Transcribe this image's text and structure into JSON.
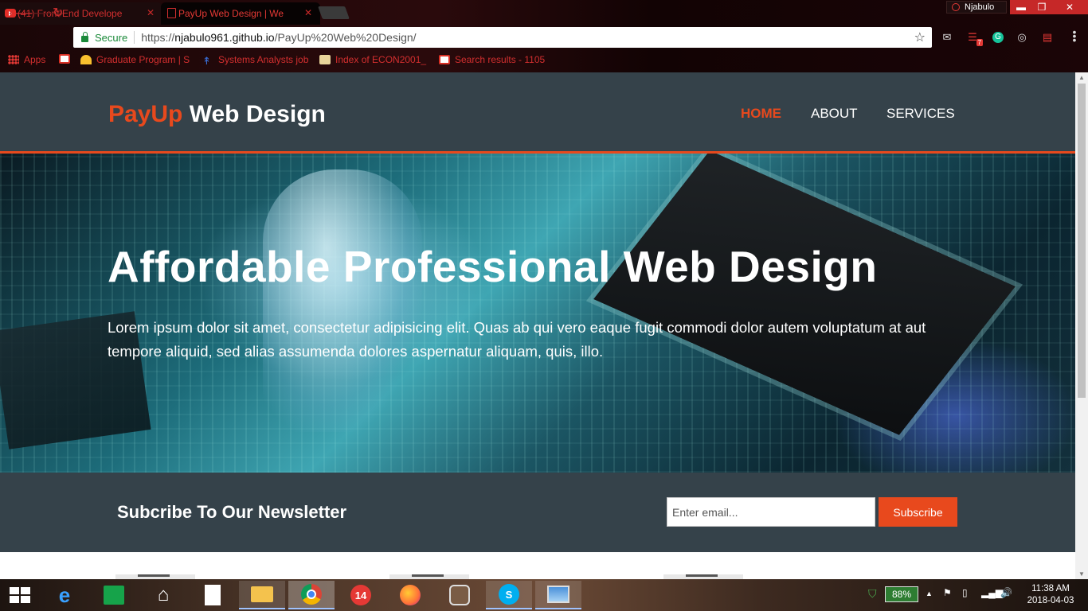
{
  "browser": {
    "tabs": [
      {
        "title": "(41) Front End Develope",
        "state": "inactive"
      },
      {
        "title": "PayUp Web Design | We",
        "state": "active"
      }
    ],
    "profile_name": "Njabulo",
    "window_controls": {
      "minimize": "▬",
      "maximize": "❐",
      "close": "✕"
    },
    "omnibox": {
      "secure_label": "Secure",
      "url_scheme": "https://",
      "url_host": "njabulo961.github.io",
      "url_path": "/PayUp%20Web%20Design/"
    },
    "extension_badges": {
      "mail": "",
      "todoist": "7"
    },
    "bookmarks": [
      {
        "label": "Apps",
        "icon": "apps-grid-icon"
      },
      {
        "label": "",
        "icon": "gmail-icon"
      },
      {
        "label": "Graduate Program | S",
        "icon": "umbrella-icon"
      },
      {
        "label": "Systems Analysts job",
        "icon": "arrow-up-icon"
      },
      {
        "label": "Index of ECON2001_",
        "icon": "folder-icon"
      },
      {
        "label": "Search results - 1105",
        "icon": "gmail-icon"
      }
    ]
  },
  "site": {
    "logo_highlight": "PayUp",
    "logo_rest": " Web Design",
    "nav": [
      "HOME",
      "ABOUT",
      "SERVICES"
    ],
    "nav_current": "HOME",
    "hero": {
      "title": "Affordable Professional Web Design",
      "text": "Lorem ipsum dolor sit amet, consectetur adipisicing elit. Quas ab qui vero eaque fugit commodi dolor autem voluptatum at aut tempore aliquid, sed alias assumenda dolores aspernatur aliquam, quis, illo."
    },
    "newsletter": {
      "title": "Subcribe To Our Newsletter",
      "placeholder": "Enter email...",
      "button": "Subscribe"
    },
    "colors": {
      "accent": "#e8491d",
      "dark": "#35424a"
    }
  },
  "taskbar": {
    "apps": [
      "start-icon",
      "internet-explorer-icon",
      "store-icon",
      "home-icon",
      "file-icon",
      "file-explorer-icon",
      "chrome-icon",
      "app-14-icon",
      "firefox-icon",
      "instagram-icon",
      "skype-icon",
      "photos-icon"
    ],
    "app_14_label": "14",
    "battery": "88%",
    "time": "11:38 AM",
    "date": "2018-04-03"
  }
}
